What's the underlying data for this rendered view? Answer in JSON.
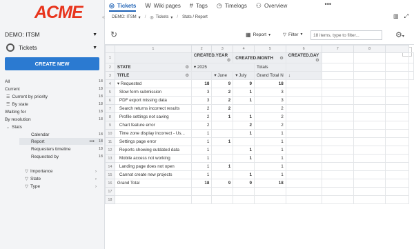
{
  "brand": "ACME",
  "sidebar": {
    "project": "DEMO: ITSM",
    "tracker": "Tickets",
    "create_label": "CREATE NEW",
    "items": [
      {
        "label": "All",
        "count": "18"
      },
      {
        "label": "Current",
        "count": "18"
      },
      {
        "label": "Current by priority",
        "count": "18"
      },
      {
        "label": "By state",
        "count": "18"
      },
      {
        "label": "Waiting for",
        "count": "18"
      },
      {
        "label": "By resolution",
        "count": "18"
      },
      {
        "label": "Stats",
        "count": ""
      },
      {
        "label": "Calendar",
        "count": "18"
      },
      {
        "label": "Report",
        "count": "18"
      },
      {
        "label": "Requesters timeline",
        "count": "18"
      },
      {
        "label": "Requested by",
        "count": "18"
      }
    ],
    "filters": [
      "Importance",
      "State",
      "Type"
    ]
  },
  "topbar": {
    "tabs": [
      {
        "label": "Tickets",
        "icon": "tickets-icon"
      },
      {
        "label": "Wiki pages",
        "icon": "wiki-icon"
      },
      {
        "label": "Tags",
        "icon": "hash-icon"
      },
      {
        "label": "Timelogs",
        "icon": "clock-icon"
      },
      {
        "label": "Overview",
        "icon": "overview-icon"
      }
    ],
    "more": "•••"
  },
  "breadcrumb": {
    "project": "DEMO: ITSM",
    "tracker": "Tickets",
    "page": "Stats / Report"
  },
  "toolbar": {
    "report_label": "Report",
    "filter_label": "Filter",
    "search_placeholder": "18 items, type to filter..."
  },
  "grid": {
    "col_letters": [
      "1",
      "2",
      "3",
      "4",
      "5",
      "6",
      "7",
      "8"
    ],
    "row_numbers": [
      "1",
      "2",
      "3",
      "4",
      "5",
      "6",
      "7",
      "8",
      "9",
      "10",
      "11",
      "12",
      "13",
      "14",
      "15",
      "16",
      "17",
      "18"
    ],
    "header_row1": [
      "",
      "CREATED.YEAR",
      "",
      "CREATED.MONTH",
      "",
      "CREATED.DAY"
    ],
    "header_state": "STATE",
    "header_year": "2025",
    "header_totals": "Totals",
    "header_title": "TITLE",
    "header_june": "June",
    "header_july": "July",
    "header_grand_total_n": "Grand Total N",
    "group_label": "Requested",
    "group_values": [
      "18",
      "9",
      "9",
      "18"
    ],
    "rows": [
      {
        "title": "Slow form submission",
        "v": [
          "3",
          "2",
          "1",
          "3"
        ]
      },
      {
        "title": "PDF export missing data",
        "v": [
          "3",
          "2",
          "1",
          "3"
        ]
      },
      {
        "title": "Search returns incorrect results",
        "v": [
          "2",
          "2",
          "",
          "2"
        ]
      },
      {
        "title": "Profile settings not saving",
        "v": [
          "2",
          "1",
          "1",
          "2"
        ]
      },
      {
        "title": "Chart feature error",
        "v": [
          "2",
          "",
          "2",
          "2"
        ]
      },
      {
        "title": "Time zone display incorrect - Us...",
        "v": [
          "1",
          "",
          "1",
          "1"
        ]
      },
      {
        "title": "Settings page error",
        "v": [
          "1",
          "1",
          "",
          "1"
        ]
      },
      {
        "title": "Reports showing outdated data",
        "v": [
          "1",
          "",
          "1",
          "1"
        ]
      },
      {
        "title": "Mobile access not working",
        "v": [
          "1",
          "",
          "1",
          "1"
        ]
      },
      {
        "title": "Landing page does not open",
        "v": [
          "1",
          "1",
          "",
          "1"
        ]
      },
      {
        "title": "Cannot create new projects",
        "v": [
          "1",
          "",
          "1",
          "1"
        ]
      }
    ],
    "grand_total_label": "Grand Total",
    "grand_total_values": [
      "18",
      "9",
      "9",
      "18"
    ]
  }
}
